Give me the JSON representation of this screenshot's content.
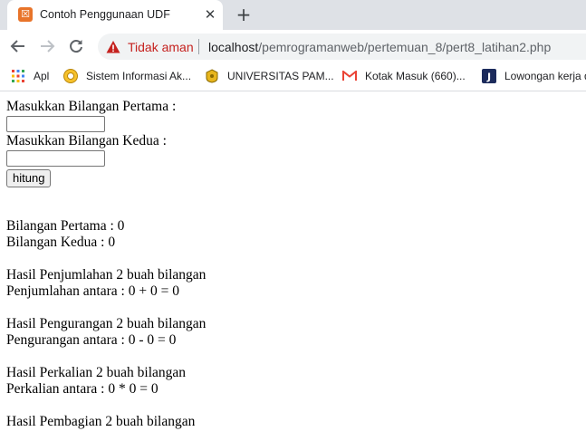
{
  "browser": {
    "tab": {
      "title": "Contoh Penggunaan UDF",
      "close_glyph": "✕",
      "favicon_glyph": "☒"
    },
    "new_tab_glyph": "+",
    "omnibox": {
      "security_label": "Tidak aman",
      "url_host": "localhost",
      "url_path": "/pemrogramanweb/pertemuan_8/pert8_latihan2.php"
    },
    "bookmarks": [
      {
        "label": "Apl",
        "icon": "apps-grid-icon"
      },
      {
        "label": "Sistem Informasi Ak...",
        "icon": "globe-icon"
      },
      {
        "label": "UNIVERSITAS PAM...",
        "icon": "university-logo-icon"
      },
      {
        "label": "Kotak Masuk (660)...",
        "icon": "gmail-icon"
      },
      {
        "label": "Lowongan kerja de",
        "icon": "jobstreet-icon"
      }
    ]
  },
  "form": {
    "label_first": "Masukkan Bilangan Pertama :",
    "value_first": "",
    "label_second": "Masukkan Bilangan Kedua :",
    "value_second": "",
    "submit_label": "hitung"
  },
  "results": {
    "first": "Bilangan Pertama : 0",
    "second": "Bilangan Kedua : 0",
    "add_heading": "Hasil Penjumlahan 2 buah bilangan",
    "add_result": "Penjumlahan antara : 0 + 0 = 0",
    "sub_heading": "Hasil Pengurangan 2 buah bilangan",
    "sub_result": "Pengurangan antara : 0 - 0 = 0",
    "mul_heading": "Hasil Perkalian 2 buah bilangan",
    "mul_result": "Perkalian antara : 0 * 0 = 0",
    "div_heading": "Hasil Pembagian 2 buah bilangan"
  },
  "colors": {
    "tabstrip": "#dee1e6",
    "insecure": "#c5221f",
    "favicon": "#e8742a"
  }
}
